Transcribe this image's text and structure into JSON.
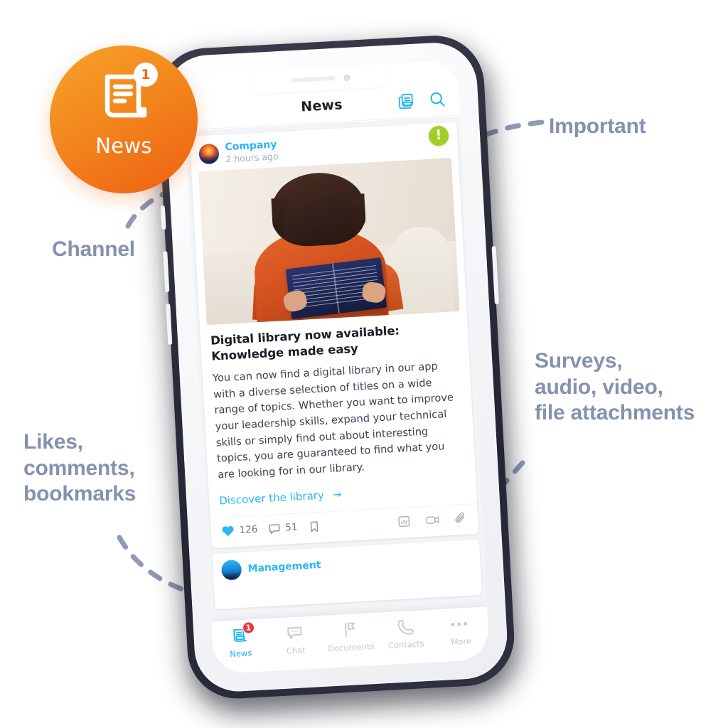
{
  "annotations": {
    "important": "Important",
    "channel": "Channel",
    "likes": "Likes,\ncomments,\nbookmarks",
    "attachments": "Surveys,\naudio, video,\nfile attachments"
  },
  "channel_bubble": {
    "label": "News",
    "badge": "1",
    "icon": "news-document-icon",
    "color_start": "#F7A32A",
    "color_end": "#EF5F14"
  },
  "phone": {
    "app": {
      "header": {
        "title": "News",
        "icons": [
          "news-stack-icon",
          "search-icon"
        ]
      },
      "feed": [
        {
          "channel": "Company",
          "timestamp": "2 hours ago",
          "important_badge": "!",
          "image_alt": "woman-reading-book-photo",
          "title": "Digital library now available: Knowledge made easy",
          "body": "You can now find a digital library in our app with a diverse selection of titles on a wide range of topics. Whether you want to improve your leadership skills, expand your technical skills or simply find out about interesting topics, you are guaranteed to find what you are looking for in our library.",
          "link": "Discover the library",
          "link_arrow": "→",
          "actions": {
            "likes": "126",
            "comments": "51",
            "bookmark_icon": "bookmark-icon",
            "survey_icon": "survey-chart-icon",
            "video_icon": "video-camera-icon",
            "attachment_icon": "paperclip-icon"
          }
        },
        {
          "channel": "Management"
        }
      ],
      "tabbar": [
        {
          "label": "News",
          "icon": "news-icon",
          "active": true,
          "badge": "1"
        },
        {
          "label": "Chat",
          "icon": "chat-bubble-icon",
          "active": false
        },
        {
          "label": "Documents",
          "icon": "documents-flag-icon",
          "active": false
        },
        {
          "label": "Contacts",
          "icon": "phone-icon",
          "active": false
        },
        {
          "label": "More",
          "icon": "more-dots-icon",
          "active": false
        }
      ]
    }
  },
  "colors": {
    "accent_blue": "#29B6F6",
    "annotation_text": "#8491B0",
    "important_green": "#A2CE28",
    "badge_red": "#F0353A",
    "orange": "#EF6A14"
  }
}
